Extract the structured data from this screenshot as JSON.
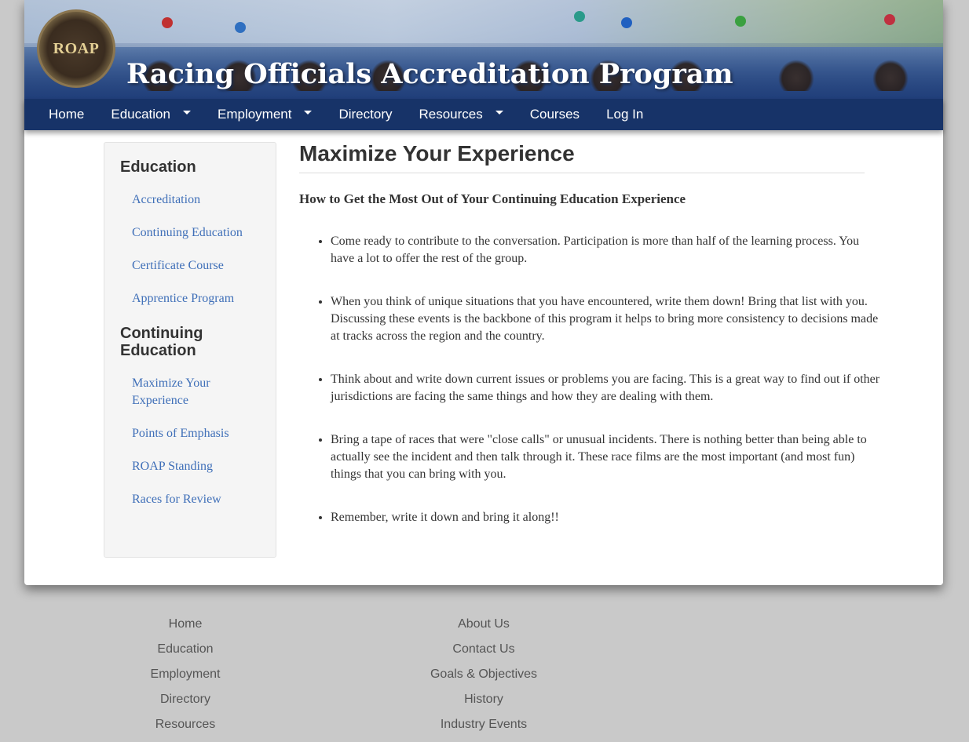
{
  "banner": {
    "logo_text": "ROAP",
    "title": "Racing Officials Accreditation Program"
  },
  "nav": {
    "items": [
      {
        "label": "Home",
        "has_dropdown": false
      },
      {
        "label": "Education",
        "has_dropdown": true
      },
      {
        "label": "Employment",
        "has_dropdown": true
      },
      {
        "label": "Directory",
        "has_dropdown": false
      },
      {
        "label": "Resources",
        "has_dropdown": true
      },
      {
        "label": "Courses",
        "has_dropdown": false
      },
      {
        "label": "Log In",
        "has_dropdown": false
      }
    ]
  },
  "sidebar": {
    "section1": {
      "heading": "Education",
      "links": [
        "Accreditation",
        "Continuing Education",
        "Certificate Course",
        "Apprentice Program"
      ]
    },
    "section2": {
      "heading": "Continuing Education",
      "links": [
        "Maximize Your Experience",
        "Points of Emphasis",
        "ROAP Standing",
        "Races for Review"
      ]
    }
  },
  "main": {
    "title": "Maximize Your Experience",
    "subtitle": "How to Get the Most Out of Your Continuing Education Experience",
    "bullets": [
      "Come ready to contribute to the conversation. Participation is more than half of the learning process. You have a lot to offer the rest of the group.",
      "When you think of unique situations that you have encountered, write them down! Bring that list with you. Discussing these events is the backbone of this program it helps to bring more consistency to decisions made at tracks across the region and the country.",
      "Think about and write down current issues or problems you are facing. This is a great way to find out if other jurisdictions are facing the same things and how they are dealing with them.",
      "Bring a tape of races that were \"close calls\" or unusual incidents. There is nothing better than being able to actually see the incident and then talk through it. These race films are the most important (and most fun) things that you can bring with you.",
      "Remember, write it down and bring it along!!"
    ]
  },
  "footer": {
    "col1": [
      "Home",
      "Education",
      "Employment",
      "Directory",
      "Resources"
    ],
    "col2": [
      "About Us",
      "Contact Us",
      "Goals & Objectives",
      "History",
      "Industry Events"
    ]
  },
  "colors": {
    "nav_bg": "#173368",
    "link": "#3f6fb8",
    "page_bg": "#c9c9c9"
  }
}
